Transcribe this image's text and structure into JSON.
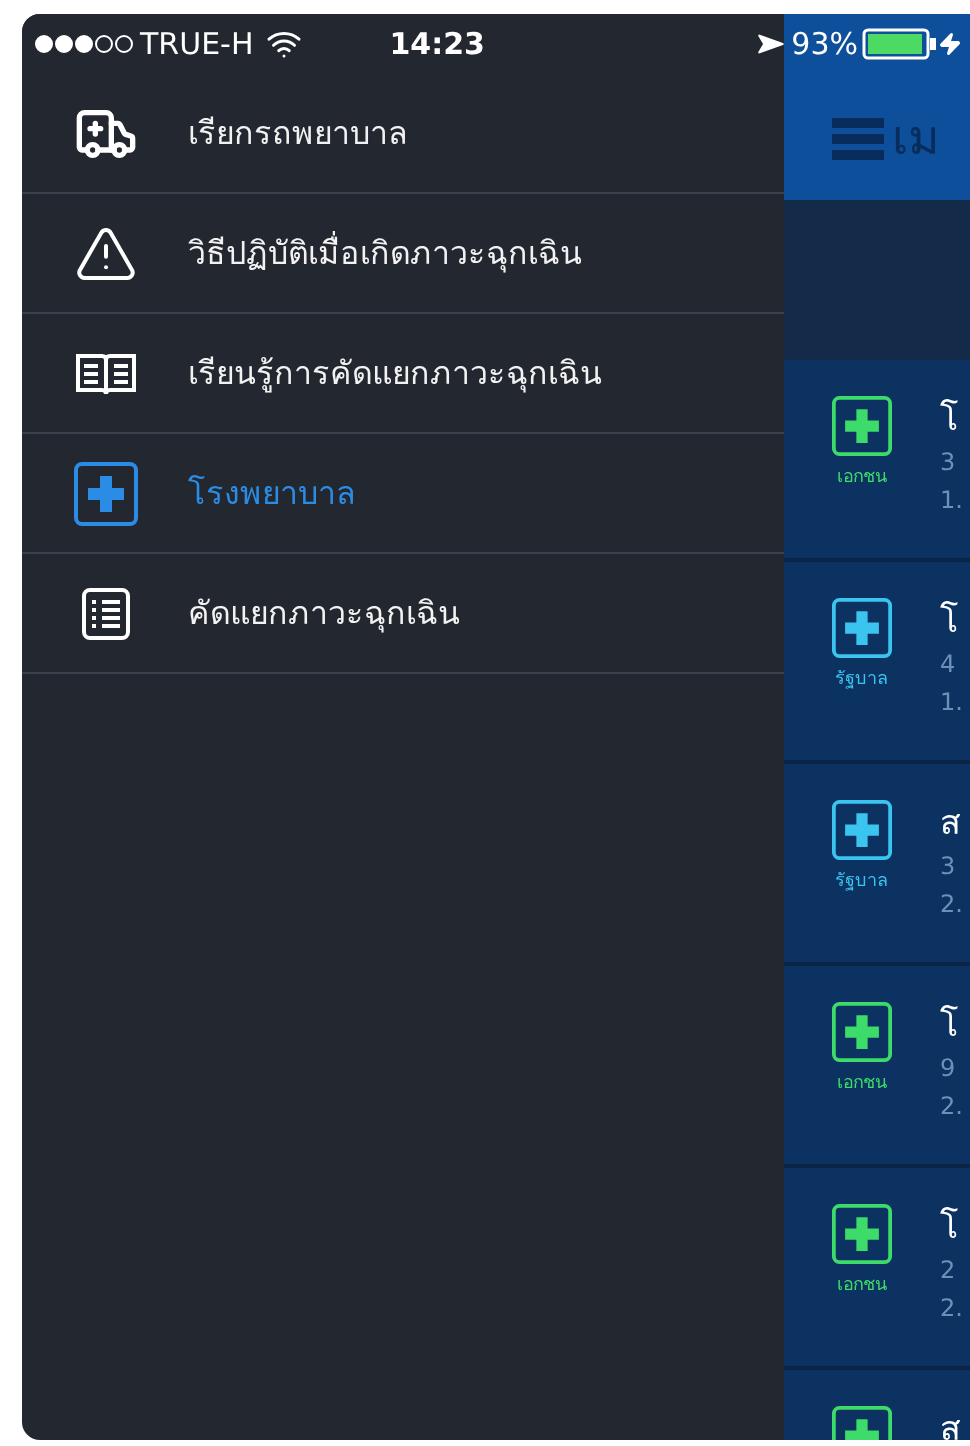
{
  "status_bar": {
    "carrier": "TRUE-H",
    "time": "14:23",
    "battery": "93%"
  },
  "drawer": {
    "items": [
      {
        "kind": "ambulance",
        "label": "เรียกรถพยาบาล",
        "selected": false
      },
      {
        "kind": "warning",
        "label": "วิธีปฏิบัติเมื่อเกิดภาวะฉุกเฉิน",
        "selected": false
      },
      {
        "kind": "book",
        "label": "เรียนรู้การคัดแยกภาวะฉุกเฉิน",
        "selected": false
      },
      {
        "kind": "hospital",
        "label": "โรงพยาบาล",
        "selected": true
      },
      {
        "kind": "list",
        "label": "คัดแยกภาวะฉุกเฉิน",
        "selected": false
      }
    ]
  },
  "main": {
    "header_title": "เม",
    "rows": [
      {
        "badge": "เอกชน",
        "color": "#3ddc6a",
        "title": "โ",
        "line_1": "3",
        "line_2": "1."
      },
      {
        "badge": "รัฐบาล",
        "color": "#3cc4f0",
        "title": "โ",
        "line_1": "4",
        "line_2": "1."
      },
      {
        "badge": "รัฐบาล",
        "color": "#3cc4f0",
        "title": "ส",
        "line_1": "3",
        "line_2": "2."
      },
      {
        "badge": "เอกชน",
        "color": "#3ddc6a",
        "title": "โ",
        "line_1": "9",
        "line_2": "2."
      },
      {
        "badge": "เอกชน",
        "color": "#3ddc6a",
        "title": "โ",
        "line_1": "2",
        "line_2": "2."
      },
      {
        "color": "#3ddc6a",
        "title": "ส"
      }
    ]
  }
}
